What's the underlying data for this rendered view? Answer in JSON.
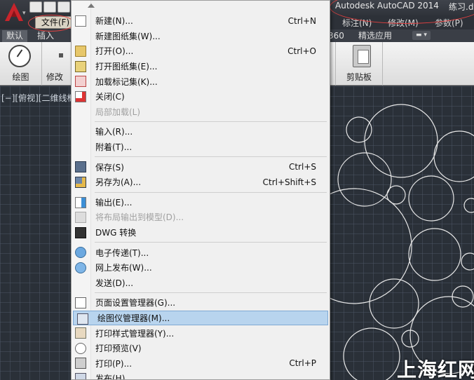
{
  "titlebar": {
    "title": "Autodesk AutoCAD 2014",
    "file": "练习.dv"
  },
  "menubar": {
    "file_label": "文件(F)",
    "right_items": [
      "标注(N)",
      "修改(M)",
      "参数(P)"
    ]
  },
  "ribbon_tabs": [
    "默认",
    "插入",
    "360",
    "精选应用"
  ],
  "ribbon": {
    "draw_label": "绘图",
    "modify_label": "修改",
    "clipboard_label": "剪贴板"
  },
  "viewport_label": "[−][俯视][二维线框",
  "watermark": "上海红网",
  "menu": {
    "items": [
      {
        "label": "新建(N)...",
        "shortcut": "Ctrl+N",
        "icon": "new-file-icon",
        "disabled": false
      },
      {
        "label": "新建图纸集(W)...",
        "shortcut": "",
        "icon": "",
        "disabled": false
      },
      {
        "label": "打开(O)...",
        "shortcut": "Ctrl+O",
        "icon": "open-folder-icon",
        "disabled": false
      },
      {
        "label": "打开图纸集(E)...",
        "shortcut": "",
        "icon": "open-sheetset-icon",
        "disabled": false
      },
      {
        "label": "加载标记集(K)...",
        "shortcut": "",
        "icon": "markup-icon",
        "disabled": false
      },
      {
        "label": "关闭(C)",
        "shortcut": "",
        "icon": "close-file-icon",
        "disabled": false
      },
      {
        "label": "局部加载(L)",
        "shortcut": "",
        "icon": "",
        "disabled": true
      },
      {
        "sep": true
      },
      {
        "label": "输入(R)...",
        "shortcut": "",
        "icon": "",
        "disabled": false
      },
      {
        "label": "附着(T)...",
        "shortcut": "",
        "icon": "",
        "disabled": false
      },
      {
        "sep": true
      },
      {
        "label": "保存(S)",
        "shortcut": "Ctrl+S",
        "icon": "save-icon",
        "disabled": false
      },
      {
        "label": "另存为(A)...",
        "shortcut": "Ctrl+Shift+S",
        "icon": "save-as-icon",
        "disabled": false
      },
      {
        "sep": true
      },
      {
        "label": "输出(E)...",
        "shortcut": "",
        "icon": "export-icon",
        "disabled": false
      },
      {
        "label": "将布局输出到模型(D)...",
        "shortcut": "",
        "icon": "layout-export-icon",
        "disabled": true
      },
      {
        "label": "DWG 转换",
        "shortcut": "",
        "icon": "dwg-convert-icon",
        "disabled": false
      },
      {
        "sep": true
      },
      {
        "label": "电子传递(T)...",
        "shortcut": "",
        "icon": "etransmit-icon",
        "disabled": false
      },
      {
        "label": "网上发布(W)...",
        "shortcut": "",
        "icon": "publish-web-icon",
        "disabled": false
      },
      {
        "label": "发送(D)...",
        "shortcut": "",
        "icon": "",
        "disabled": false
      },
      {
        "sep": true
      },
      {
        "label": "页面设置管理器(G)...",
        "shortcut": "",
        "icon": "page-setup-icon",
        "disabled": false
      },
      {
        "label": "绘图仪管理器(M)...",
        "shortcut": "",
        "icon": "plotter-manager-icon",
        "disabled": false,
        "highlight": true
      },
      {
        "label": "打印样式管理器(Y)...",
        "shortcut": "",
        "icon": "plot-style-icon",
        "disabled": false
      },
      {
        "label": "打印预览(V)",
        "shortcut": "",
        "icon": "plot-preview-icon",
        "disabled": false
      },
      {
        "label": "打印(P)...",
        "shortcut": "Ctrl+P",
        "icon": "print-icon",
        "disabled": false
      },
      {
        "label": "发布(H)...",
        "shortcut": "",
        "icon": "publish-icon",
        "disabled": false
      }
    ]
  },
  "colors": {
    "highlight": "#b8d4ee",
    "annotation": "#e04040",
    "viewport": "#2a3038"
  }
}
